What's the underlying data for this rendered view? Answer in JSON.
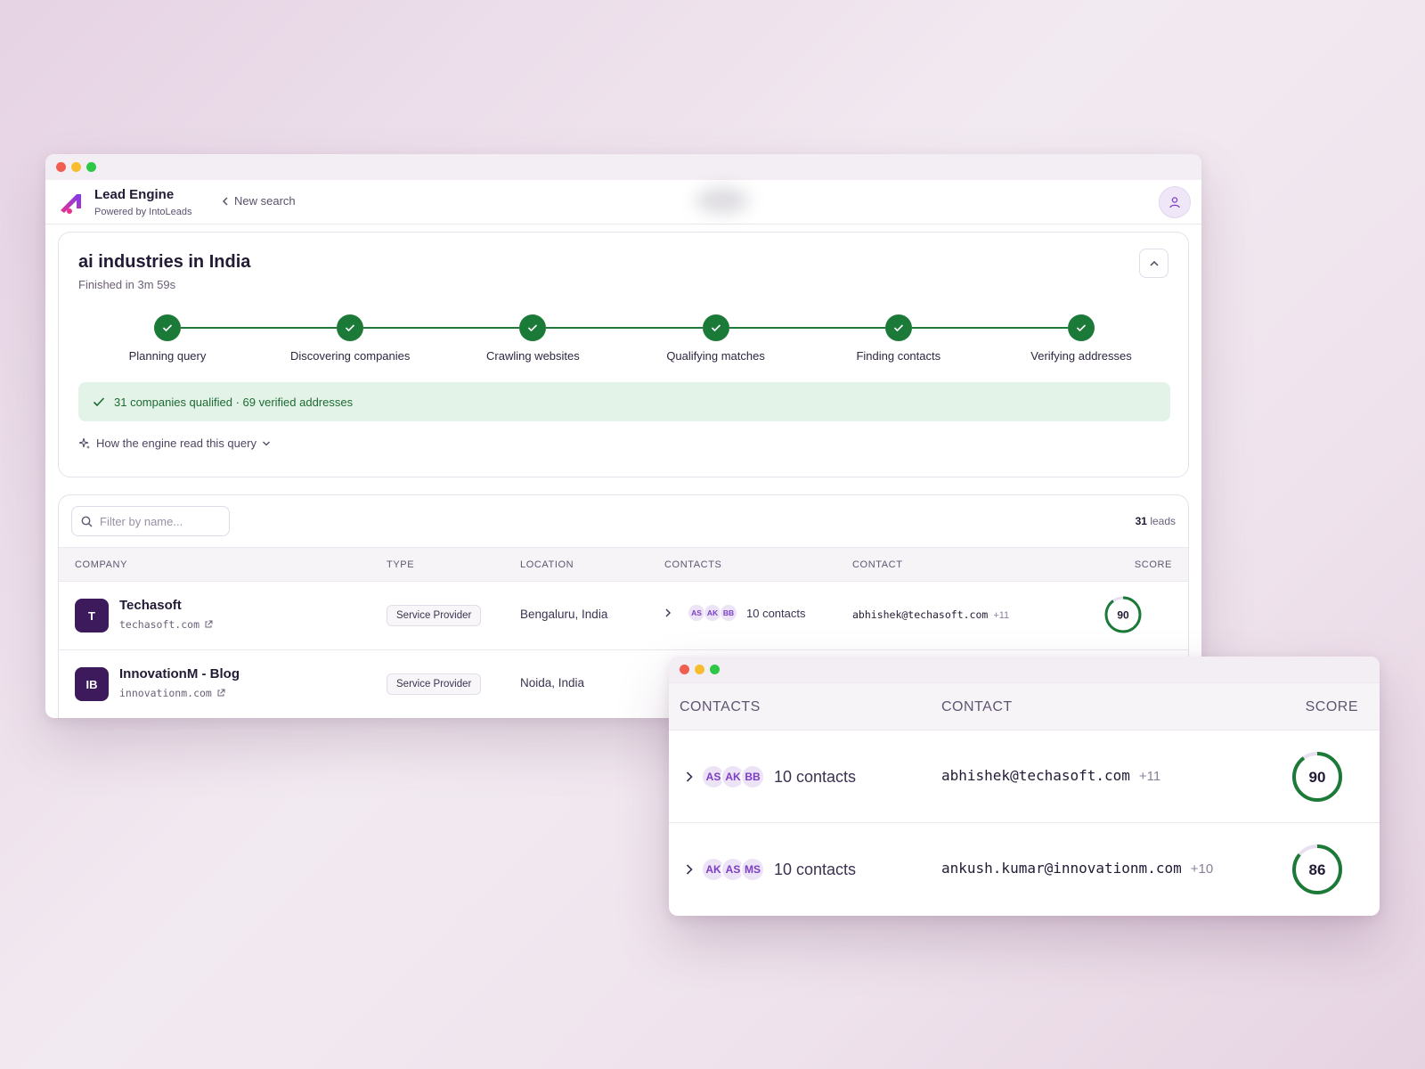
{
  "app": {
    "title": "Lead Engine",
    "subtitle": "Powered by IntoLeads",
    "new_search_label": "New search"
  },
  "search": {
    "query": "ai industries in India",
    "status": "Finished in 3m 59s",
    "steps": [
      {
        "label": "Planning query",
        "done": true
      },
      {
        "label": "Discovering companies",
        "done": true
      },
      {
        "label": "Crawling websites",
        "done": true
      },
      {
        "label": "Qualifying matches",
        "done": true
      },
      {
        "label": "Finding contacts",
        "done": true
      },
      {
        "label": "Verifying addresses",
        "done": true
      }
    ],
    "result_banner": "31 companies qualified · 69 verified addresses",
    "engine_read_label": "How the engine read this query"
  },
  "table": {
    "filter_placeholder": "Filter by name...",
    "lead_count": "31",
    "lead_count_suffix": "leads",
    "columns": {
      "company": "COMPANY",
      "type": "TYPE",
      "location": "LOCATION",
      "contacts": "CONTACTS",
      "contact": "CONTACT",
      "score": "SCORE"
    },
    "rows": [
      {
        "initials": "T",
        "name": "Techasoft",
        "domain": "techasoft.com",
        "type": "Service Provider",
        "location": "Bengaluru, India",
        "contact_initials": [
          "AS",
          "AK",
          "BB"
        ],
        "contacts_text": "10 contacts",
        "email": "abhishek@techasoft.com",
        "email_more": "+11",
        "score": 90
      },
      {
        "initials": "IB",
        "name": "InnovationM - Blog",
        "domain": "innovationm.com",
        "type": "Service Provider",
        "location": "Noida, India"
      }
    ]
  },
  "zoom": {
    "columns": {
      "contacts": "CONTACTS",
      "contact": "CONTACT",
      "score": "SCORE"
    },
    "rows": [
      {
        "contact_initials": [
          "AS",
          "AK",
          "BB"
        ],
        "contacts_text": "10 contacts",
        "email": "abhishek@techasoft.com",
        "email_more": "+11",
        "score": 90
      },
      {
        "contact_initials": [
          "AK",
          "AS",
          "MS"
        ],
        "contacts_text": "10 contacts",
        "email": "ankush.kumar@innovationm.com",
        "email_more": "+10",
        "score": 86
      }
    ]
  },
  "colors": {
    "accent_purple": "#7b3fc4",
    "success_green": "#1b7a37",
    "avatar_bg": "#3d1a5c"
  }
}
